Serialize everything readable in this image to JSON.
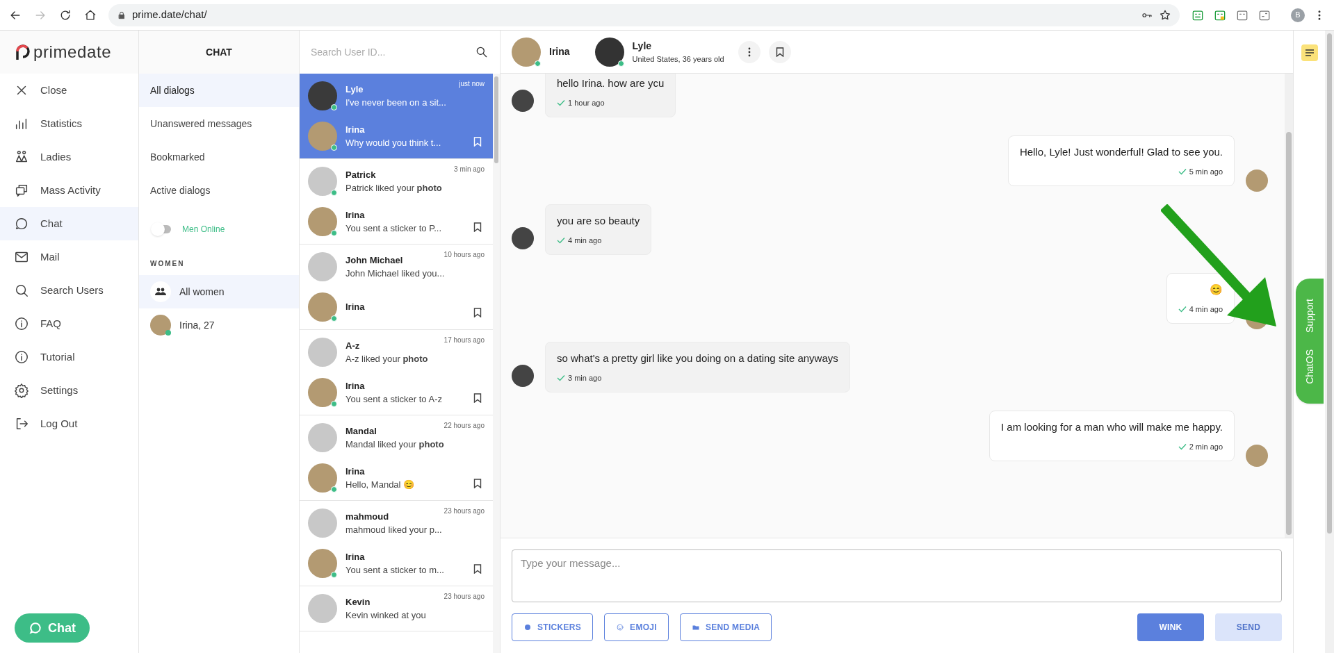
{
  "browser": {
    "url": "prime.date/chat/",
    "profile": "B"
  },
  "brand": {
    "logo": "primedate"
  },
  "nav": {
    "items": [
      {
        "label": "Close",
        "selected": false
      },
      {
        "label": "Statistics",
        "selected": false
      },
      {
        "label": "Ladies",
        "selected": false
      },
      {
        "label": "Mass Activity",
        "selected": false
      },
      {
        "label": "Chat",
        "selected": true
      },
      {
        "label": "Mail",
        "selected": false
      },
      {
        "label": "Search Users",
        "selected": false
      },
      {
        "label": "FAQ",
        "selected": false
      },
      {
        "label": "Tutorial",
        "selected": false
      },
      {
        "label": "Settings",
        "selected": false
      },
      {
        "label": "Log Out",
        "selected": false
      }
    ]
  },
  "chat_button": {
    "label": "Chat"
  },
  "filters": {
    "title": "CHAT",
    "items": [
      {
        "label": "All dialogs",
        "selected": true
      },
      {
        "label": "Unanswered messages",
        "selected": false
      },
      {
        "label": "Bookmarked",
        "selected": false
      },
      {
        "label": "Active dialogs",
        "selected": false
      }
    ],
    "men_online": {
      "label": "Men Online",
      "on": false
    },
    "women_title": "WOMEN",
    "women": [
      {
        "kind": "group",
        "label": "All women",
        "selected": true
      },
      {
        "kind": "person",
        "label": "Irina, 27",
        "selected": false,
        "online": true
      }
    ]
  },
  "dialogs": {
    "search": {
      "placeholder": "Search User ID..."
    },
    "items": [
      {
        "selected": true,
        "man": {
          "name": "Lyle",
          "time": "just now",
          "preview": "I've never been on a sit...",
          "online": true
        },
        "woman": {
          "name": "Irina",
          "preview": "Why would you think t...",
          "online": true
        }
      },
      {
        "selected": false,
        "man": {
          "name": "Patrick",
          "time": "3 min ago",
          "preview": "Patrick liked your **photo**",
          "online": true
        },
        "woman": {
          "name": "Irina",
          "preview": "You sent a sticker to P...",
          "online": true
        }
      },
      {
        "selected": false,
        "man": {
          "name": "John Michael",
          "time": "10 hours ago",
          "preview": "John Michael liked you...",
          "online": false
        },
        "woman": {
          "name": "Irina",
          "online": true
        }
      },
      {
        "selected": false,
        "man": {
          "name": "A-z",
          "time": "17 hours ago",
          "preview": "A-z liked your **photo**",
          "online": false
        },
        "woman": {
          "name": "Irina",
          "preview": "You sent a sticker to A-z",
          "online": true
        }
      },
      {
        "selected": false,
        "man": {
          "name": "Mandal",
          "time": "22 hours ago",
          "preview": "Mandal liked your **photo**",
          "online": false
        },
        "woman": {
          "name": "Irina",
          "preview": "Hello, Mandal 😊",
          "online": true
        }
      },
      {
        "selected": false,
        "man": {
          "name": "mahmoud",
          "time": "23 hours ago",
          "preview": "mahmoud liked your p...",
          "online": false
        },
        "woman": {
          "name": "Irina",
          "preview": "You sent a sticker to m...",
          "online": true
        }
      },
      {
        "selected": false,
        "man": {
          "name": "Kevin",
          "time": "23 hours ago",
          "preview": "Kevin winked at you",
          "online": false
        }
      }
    ]
  },
  "chat_header": {
    "woman": {
      "name": "Irina",
      "online": true
    },
    "man": {
      "name": "Lyle",
      "subtitle": "United States, 36 years old",
      "online": true
    }
  },
  "messages": [
    {
      "kind": "incoming",
      "text": "hello Irina. how are ycu",
      "time": "1 hour ago"
    },
    {
      "kind": "outgoing",
      "text": "Hello, Lyle! Just wonderful! Glad to see you.",
      "time": "5 min ago"
    },
    {
      "kind": "incoming",
      "text": "you are so beauty",
      "time": "4 min ago"
    },
    {
      "kind": "outgoing",
      "text": "😊",
      "time": "4 min ago"
    },
    {
      "kind": "incoming",
      "text": "so what's a pretty girl like you doing on a dating site anyways",
      "time": "3 min ago"
    },
    {
      "kind": "outgoing",
      "text": "I am looking for a man who will make me happy.",
      "time": "2 min ago"
    }
  ],
  "composer": {
    "placeholder": "Type your message...",
    "tools": [
      "STICKERS",
      "EMOJI",
      "SEND MEDIA"
    ],
    "wink": {
      "label": "WINK",
      "disabled": false
    },
    "send": {
      "label": "SEND",
      "disabled": true
    }
  },
  "support_tab": {
    "labels": [
      "Support",
      "ChatOS"
    ]
  }
}
